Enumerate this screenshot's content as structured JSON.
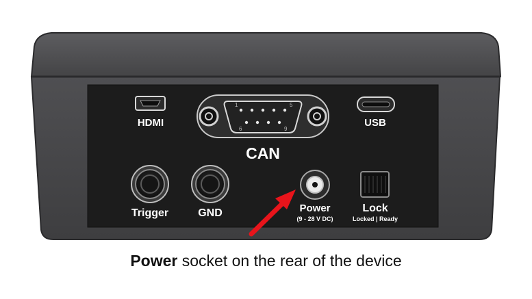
{
  "device": {
    "ports": {
      "hdmi": "HDMI",
      "can": "CAN",
      "usb": "USB",
      "trigger": "Trigger",
      "gnd": "GND",
      "power": "Power",
      "power_spec": "(9 - 28 V DC)",
      "lock": "Lock",
      "lock_states": "Locked | Ready"
    },
    "dsub_pins": {
      "pin_1": "1",
      "pin_5": "5",
      "pin_6": "6",
      "pin_9": "9"
    }
  },
  "caption": {
    "bold": "Power",
    "rest": " socket on the rear of the device"
  },
  "colors": {
    "housing": "#4a4a4c",
    "panel": "#1c1c1c",
    "arrow": "#e8141b",
    "label": "#ffffff"
  }
}
